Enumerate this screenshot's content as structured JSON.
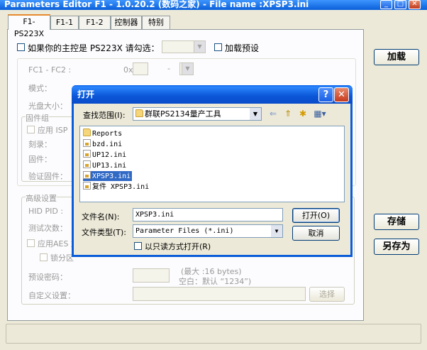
{
  "window": {
    "title": "Parameters Editor F1 - 1.0.20.2 (数码之家) - File name :XPSP3.ini"
  },
  "tabs": [
    {
      "label": "F1-PS223X"
    },
    {
      "label": "F1-1"
    },
    {
      "label": "F1-2"
    },
    {
      "label": "控制器"
    },
    {
      "label": "特别"
    }
  ],
  "panel": {
    "check_controller_label": "如果你的主控是 PS223X 请勾选：",
    "load_preset_label": "加载预设",
    "fc_label": "FC1 - FC2 :",
    "fc_prefix": "0x",
    "fc_dash": "-",
    "mode_label": "模式：",
    "disc_size_label": "光盘大小：",
    "firmware_group": "固件组",
    "use_isp_label": "应用 ISP",
    "burn_label": "刻录：",
    "firmware_label": "固件：",
    "verify_firmware_label": "验证固件：",
    "advanced_group": "高级设置",
    "hid_pid_label": "HID PID :",
    "test_count_label": "测试次数：",
    "use_aes_label": "应用AES 加",
    "lock_zone_label": "锁分区",
    "preset_password_label": "预设密码：",
    "max_hint": "(最大 :16 bytes)",
    "empty_hint": "空白：默认 “1234”)",
    "custom_setting_label": "自定义设置：",
    "select_button": "选择"
  },
  "right_buttons": {
    "load": "加载",
    "save": "存储",
    "save_as": "另存为"
  },
  "dialog": {
    "title": "打开",
    "help_glyph": "?",
    "close_glyph": "✕",
    "look_in_label": "查找范围(I):",
    "look_in_value": "群联PS2134量产工具",
    "files": [
      {
        "name": "Reports",
        "type": "folder"
      },
      {
        "name": "bzd.ini",
        "type": "ini"
      },
      {
        "name": "UP12.ini",
        "type": "ini"
      },
      {
        "name": "UP13.ini",
        "type": "ini"
      },
      {
        "name": "XPSP3.ini",
        "type": "ini",
        "selected": true
      },
      {
        "name": "复件 XPSP3.ini",
        "type": "ini"
      }
    ],
    "filename_label": "文件名(N):",
    "filename_value": "XPSP3.ini",
    "filetype_label": "文件类型(T):",
    "filetype_value": "Parameter Files (*.ini)",
    "readonly_label": "以只读方式打开(R)",
    "open_button": "打开(O)",
    "cancel_button": "取消"
  }
}
